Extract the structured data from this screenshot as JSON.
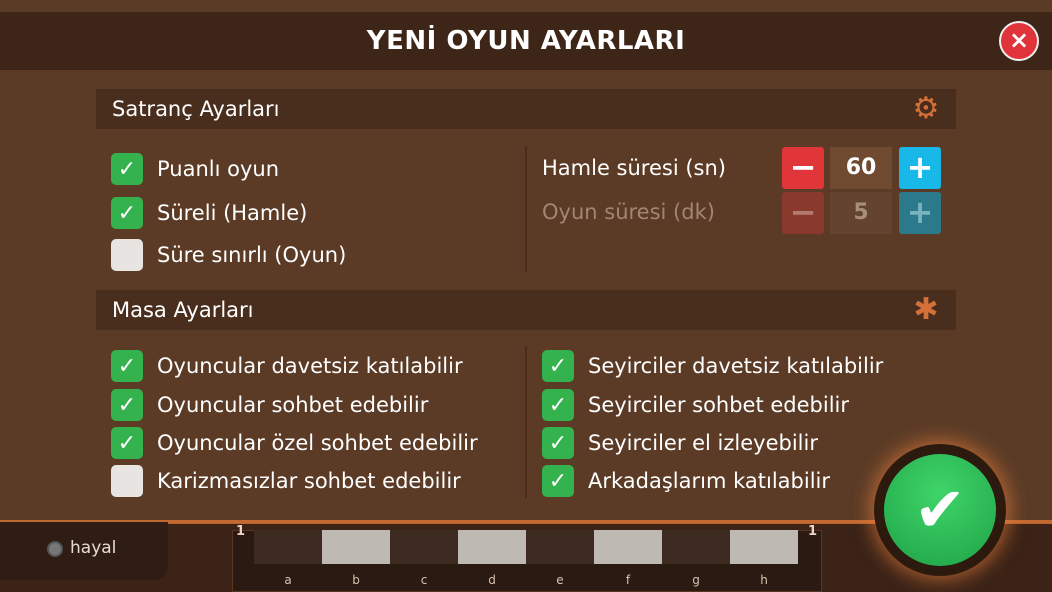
{
  "modal": {
    "title": "YENİ OYUN AYARLARI",
    "close_icon": "×"
  },
  "chess_settings": {
    "title": "Satranç Ayarları",
    "gear_icon": "⚙",
    "options": [
      {
        "label": "Puanlı oyun",
        "checked": true
      },
      {
        "label": "Süreli (Hamle)",
        "checked": true
      },
      {
        "label": "Süre sınırlı (Oyun)",
        "checked": false
      }
    ],
    "move_time": {
      "label": "Hamle süresi (sn)",
      "value": "60",
      "enabled": true
    },
    "game_time": {
      "label": "Oyun süresi (dk)",
      "value": "5",
      "enabled": false
    },
    "minus": "−",
    "plus": "+"
  },
  "table_settings": {
    "title": "Masa Ayarları",
    "icon": "✱",
    "left_options": [
      {
        "label": "Oyuncular davetsiz katılabilir",
        "checked": true
      },
      {
        "label": "Oyuncular sohbet edebilir",
        "checked": true
      },
      {
        "label": "Oyuncular özel sohbet edebilir",
        "checked": true
      },
      {
        "label": "Karizmasızlar sohbet edebilir",
        "checked": false
      }
    ],
    "right_options": [
      {
        "label": "Seyirciler davetsiz katılabilir",
        "checked": true
      },
      {
        "label": "Seyirciler sohbet edebilir",
        "checked": true
      },
      {
        "label": "Seyirciler el izleyebilir",
        "checked": true
      },
      {
        "label": "Arkadaşlarım katılabilir",
        "checked": true
      }
    ]
  },
  "check_mark": "✓",
  "confirm_icon": "✔",
  "background": {
    "player_name": "hayal",
    "rank_left": "1",
    "rank_right": "1",
    "files": [
      "a",
      "b",
      "c",
      "d",
      "e",
      "f",
      "g",
      "h"
    ]
  }
}
